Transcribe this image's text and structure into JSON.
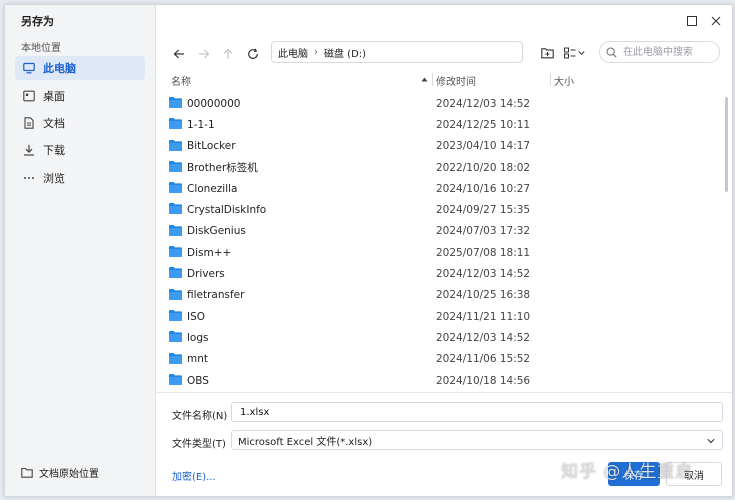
{
  "dialog": {
    "title": "另存为"
  },
  "sidebar": {
    "section_label": "本地位置",
    "items": [
      {
        "label": "此电脑",
        "icon": "computer-icon",
        "active": true
      },
      {
        "label": "桌面",
        "icon": "desktop-icon",
        "active": false
      },
      {
        "label": "文档",
        "icon": "document-icon",
        "active": false
      },
      {
        "label": "下载",
        "icon": "download-icon",
        "active": false
      },
      {
        "label": "浏览",
        "icon": "more-icon",
        "active": false
      }
    ],
    "bottom_link": "文档原始位置"
  },
  "breadcrumb": {
    "items": [
      "此电脑",
      "磁盘 (D:)"
    ]
  },
  "search": {
    "placeholder": "在此电脑中搜索"
  },
  "columns": {
    "name": "名称",
    "modified": "修改时间",
    "size": "大小"
  },
  "files": [
    {
      "name": "00000000",
      "modified": "2024/12/03 14:52"
    },
    {
      "name": "1-1-1",
      "modified": "2024/12/25 10:11"
    },
    {
      "name": "BitLocker",
      "modified": "2023/04/10 14:17"
    },
    {
      "name": "Brother标签机",
      "modified": "2022/10/20 18:02"
    },
    {
      "name": "Clonezilla",
      "modified": "2024/10/16 10:27"
    },
    {
      "name": "CrystalDiskInfo",
      "modified": "2024/09/27 15:35"
    },
    {
      "name": "DiskGenius",
      "modified": "2024/07/03 17:32"
    },
    {
      "name": "Dism++",
      "modified": "2025/07/08 18:11"
    },
    {
      "name": "Drivers",
      "modified": "2024/12/03 14:52"
    },
    {
      "name": "filetransfer",
      "modified": "2024/10/25 16:38"
    },
    {
      "name": "ISO",
      "modified": "2024/11/21 11:10"
    },
    {
      "name": "logs",
      "modified": "2024/12/03 14:52"
    },
    {
      "name": "mnt",
      "modified": "2024/11/06 15:52"
    },
    {
      "name": "OBS",
      "modified": "2024/10/18 14:56"
    }
  ],
  "form": {
    "filename_label": "文件名称(N)",
    "filename_value": "1.xlsx",
    "filetype_label": "文件类型(T)",
    "filetype_value": "Microsoft Excel 文件(*.xlsx)"
  },
  "footer": {
    "encrypt_link": "加密(E)...",
    "save_label": "保存",
    "cancel_label": "取消"
  },
  "watermark": {
    "text": "知乎 @人生重启"
  },
  "colors": {
    "accent": "#1f6fd6",
    "folder": "#1e88e5"
  }
}
